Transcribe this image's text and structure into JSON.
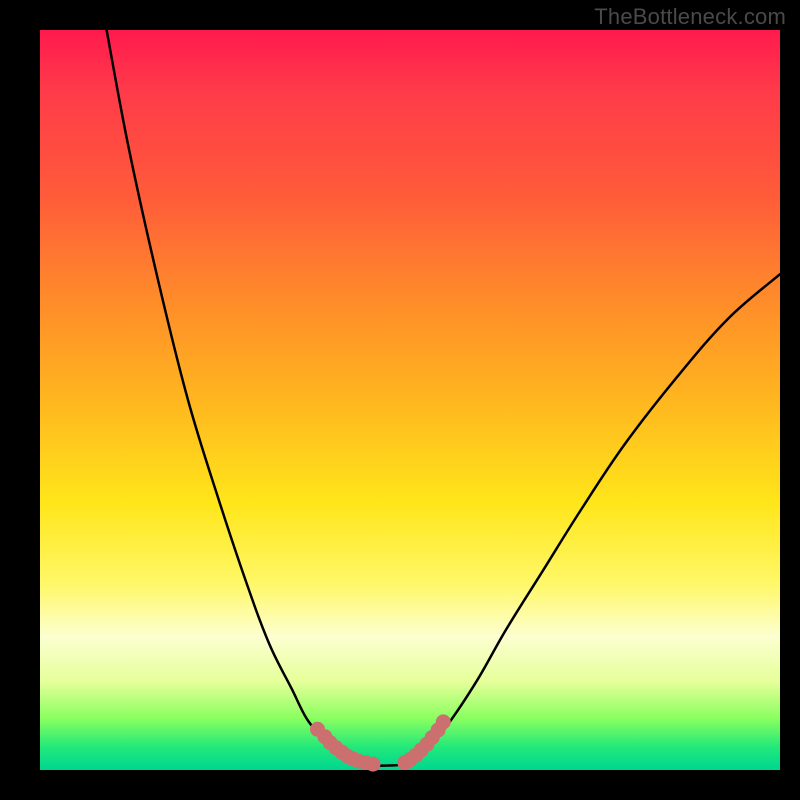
{
  "watermark": "TheBottleneck.com",
  "colors": {
    "background_frame": "#000000",
    "curve_stroke": "#000000",
    "marker_fill": "#cc6f6f",
    "gradient_top": "#ff1a4d",
    "gradient_bottom": "#00d690"
  },
  "chart_data": {
    "type": "line",
    "title": "",
    "xlabel": "",
    "ylabel": "",
    "xlim": [
      0,
      100
    ],
    "ylim": [
      0,
      100
    ],
    "grid": false,
    "legend": false,
    "note": "No axes, ticks, or labels are rendered in the image. Values are estimated from pixel positions inside the 740×740 plot area. y=0 at bottom, y=100 at top.",
    "series": [
      {
        "name": "left-curve",
        "type": "line",
        "x": [
          9,
          12,
          16,
          20,
          24,
          28,
          31,
          34,
          36,
          38,
          39.5,
          41,
          43
        ],
        "y": [
          100,
          84,
          66,
          50,
          37,
          25,
          17,
          11,
          7,
          4.5,
          2.8,
          1.5,
          0.8
        ]
      },
      {
        "name": "right-curve",
        "type": "line",
        "x": [
          50,
          52,
          55,
          59,
          63,
          68,
          73,
          79,
          86,
          93,
          100
        ],
        "y": [
          1.0,
          2.5,
          6,
          12,
          19,
          27,
          35,
          44,
          53,
          61,
          67
        ]
      },
      {
        "name": "valley-floor",
        "type": "line",
        "x": [
          43,
          45,
          47,
          49,
          50
        ],
        "y": [
          0.8,
          0.6,
          0.6,
          0.7,
          1.0
        ]
      },
      {
        "name": "left-markers",
        "type": "scatter",
        "x": [
          37.5,
          38.5,
          39.2,
          40.0,
          40.8,
          41.5,
          42.3,
          43.0,
          44.0,
          45.0
        ],
        "y": [
          5.5,
          4.5,
          3.7,
          3.0,
          2.4,
          1.9,
          1.5,
          1.2,
          1.0,
          0.8
        ]
      },
      {
        "name": "right-markers",
        "type": "scatter",
        "x": [
          49.3,
          50.0,
          50.8,
          51.5,
          52.3,
          53.0,
          53.8,
          54.5
        ],
        "y": [
          1.0,
          1.4,
          2.0,
          2.7,
          3.5,
          4.4,
          5.4,
          6.5
        ]
      }
    ]
  }
}
